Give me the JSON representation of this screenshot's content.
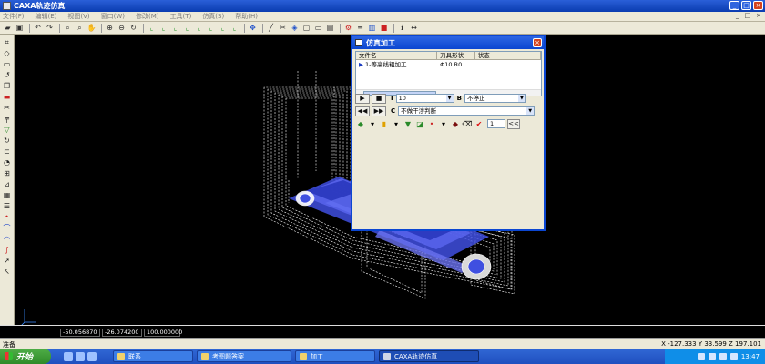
{
  "app": {
    "title": "CAXA轨迹仿真",
    "icon": "caxa-app-icon"
  },
  "window_controls": {
    "minimize": "_",
    "maximize": "□",
    "close": "×"
  },
  "menubar": {
    "items": [
      "文件(F)",
      "编辑(E)",
      "视图(V)",
      "窗口(W)",
      "修改(M)",
      "工具(T)",
      "仿真(S)",
      "帮助(H)"
    ],
    "right": [
      "_",
      "□",
      "×"
    ]
  },
  "toolbar": {
    "icons": [
      "open-icon",
      "save-icon",
      "undo-icon",
      "redo-icon",
      "zoom-icon",
      "zoom-out-icon",
      "pan-icon",
      "zoom-in-icon",
      "zoom-window-icon",
      "refresh-icon",
      "line-icon",
      "line-icon",
      "line-icon",
      "line-icon",
      "line-icon",
      "line-icon",
      "line-icon",
      "line-icon",
      "line-icon",
      "move-icon",
      "line-icon",
      "cut-icon",
      "cube-icon",
      "box-icon",
      "window-icon",
      "panel-icon",
      "tool-icon",
      "measure-icon",
      "simulate-icon",
      "info-icon",
      "ruler-icon"
    ]
  },
  "leftbar": {
    "icons": [
      "crop-icon",
      "select-icon",
      "rect-icon",
      "rotate-icon",
      "copy-icon",
      "delete-icon",
      "cut-icon",
      "align-icon",
      "filter-icon",
      "rotate-icon",
      "offset-icon",
      "shape-icon",
      "box-icon",
      "edge-icon",
      "grid-icon",
      "list-icon",
      "point-icon",
      "arc-icon",
      "arc-icon",
      "curve-icon",
      "arrow-icon",
      "cursor-icon"
    ]
  },
  "coordbar": {
    "x": "-50.056870",
    "y": "-26.074200",
    "z": "100.000000"
  },
  "statusbar": {
    "left": "准备",
    "right": "X -127.333 Y   33.599 Z  197.101"
  },
  "dialog": {
    "title": "仿真加工",
    "close": "×",
    "list": {
      "columns": [
        "文件名",
        "刀具形状",
        "状态"
      ],
      "rows": [
        {
          "name": "1-等高线粗加工",
          "tool": "Φ10 R0",
          "status": ""
        }
      ]
    },
    "controls": {
      "play": "▶",
      "stop": "■",
      "label_i": "I",
      "i_value": "10",
      "label_b": "B",
      "b_value": "不停止",
      "rewind": "◀◀",
      "forward": "▶▶",
      "label_c": "C",
      "c_value": "不做干涉判断",
      "spin_value": "1",
      "collapse": "<<"
    }
  },
  "taskbar": {
    "start": "开始",
    "tasks": [
      "联系",
      "考图题答案",
      "加工",
      "CAXA轨迹仿真"
    ],
    "clock": "13:47"
  },
  "colors": {
    "title_blue": "#0b46d1",
    "canvas": "#000000",
    "xp_green": "#3c9a3c",
    "accent_blue": "#3f4fe0"
  }
}
